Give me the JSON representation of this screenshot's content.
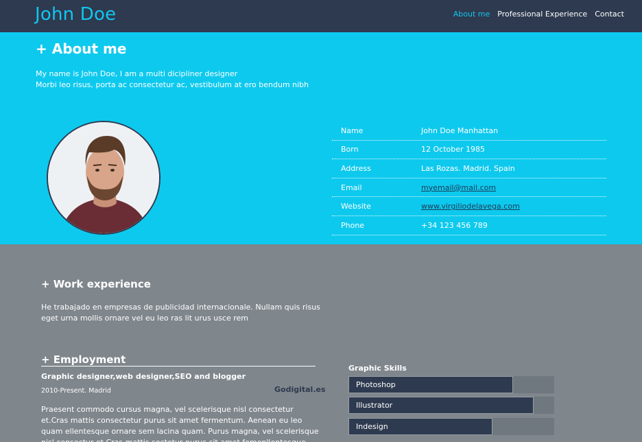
{
  "header": {
    "brand": "John Doe",
    "nav": [
      "About me",
      "Professional Experience",
      "Contact"
    ]
  },
  "about": {
    "title": "+ About me",
    "line1": "My name is John Doe, I am a multi dicipliner designer",
    "line2": "Morbi leo risus, porta ac consectetur ac, vestibulum at ero bendum nibh",
    "profile": [
      {
        "label": "Name",
        "value": "John Doe Manhattan"
      },
      {
        "label": "Born",
        "value": "12 October 1985"
      },
      {
        "label": "Address",
        "value": "Las Rozas. Madrid. Spain"
      },
      {
        "label": "Email",
        "value": "myemail@mail.com"
      },
      {
        "label": "Website",
        "value": "www.virgiliodelavega.com"
      },
      {
        "label": "Phone",
        "value": "+34 123 456 789"
      }
    ]
  },
  "work": {
    "title": "+ Work experience",
    "text": "He trabajado en empresas de publicidad internacionale. Nullam quis risus eget urna mollis ornare vel eu leo ras lit urus usce rem"
  },
  "employment": {
    "title": "+ Employment",
    "role": "Graphic designer,web designer,SEO and blogger",
    "dates": "2010-Present. Madrid",
    "company": "Godigital.es",
    "text": "Praesent commodo cursus magna, vel scelerisque nisl consectetur et.Cras mattis consectetur purus sit amet fermentum. Aenean eu leo quam ellentesque ornare sem lacina quam. Purus magna, vel scelerisque nisl consectur et.Cras mattis sectetur purus sit amet femenllentesque ornare sem lacina quam."
  },
  "skills": {
    "title": "Graphic Skills",
    "items": [
      {
        "name": "Photoshop",
        "level": 0.8
      },
      {
        "name": "Illustrator",
        "level": 0.9
      },
      {
        "name": "Indesign",
        "level": 0.7
      }
    ]
  },
  "colors": {
    "header_bg": "#2e3a4f",
    "accent": "#12c6ef",
    "about_bg": "#0ec9ee",
    "body_bg": "#7f868c"
  }
}
